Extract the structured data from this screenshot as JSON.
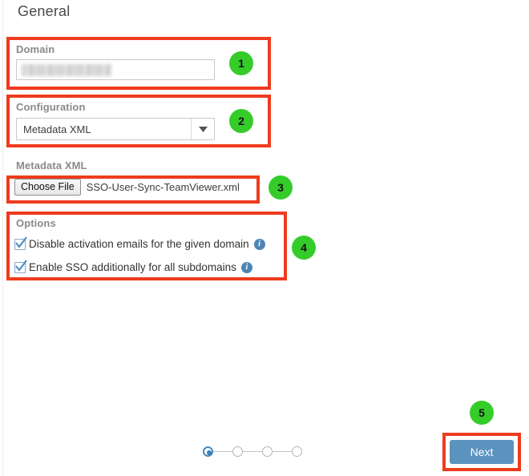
{
  "page": {
    "title": "General"
  },
  "colors": {
    "annotation_box": "#ef3b1e",
    "annotation_badge": "#35cc2a",
    "primary_button": "#5b93bf",
    "info_icon": "#4d86b5",
    "label_text": "#8a8a8a"
  },
  "domain": {
    "label": "Domain",
    "value": "",
    "placeholder": "",
    "redacted": true
  },
  "configuration": {
    "label": "Configuration",
    "selected": "Metadata XML",
    "options": [
      "Metadata XML"
    ],
    "arrow_icon": "chevron-down-icon"
  },
  "metadata": {
    "label": "Metadata XML",
    "choose_file_label": "Choose File",
    "file_name": "SSO-User-Sync-TeamViewer.xml"
  },
  "options": {
    "label": "Options",
    "items": [
      {
        "label": "Disable activation emails for the given domain",
        "checked": true,
        "info_icon": "info-icon",
        "info_glyph": "i"
      },
      {
        "label": "Enable SSO additionally for all subdomains",
        "checked": true,
        "info_icon": "info-icon",
        "info_glyph": "i"
      }
    ]
  },
  "stepper": {
    "total_steps": 4,
    "current_step": 1
  },
  "footer": {
    "next_label": "Next"
  },
  "annotations": {
    "badges": [
      {
        "number": "1",
        "target": "domain-field"
      },
      {
        "number": "2",
        "target": "configuration-select"
      },
      {
        "number": "3",
        "target": "metadata-file-input"
      },
      {
        "number": "4",
        "target": "options-group"
      },
      {
        "number": "5",
        "target": "next-button"
      }
    ]
  }
}
